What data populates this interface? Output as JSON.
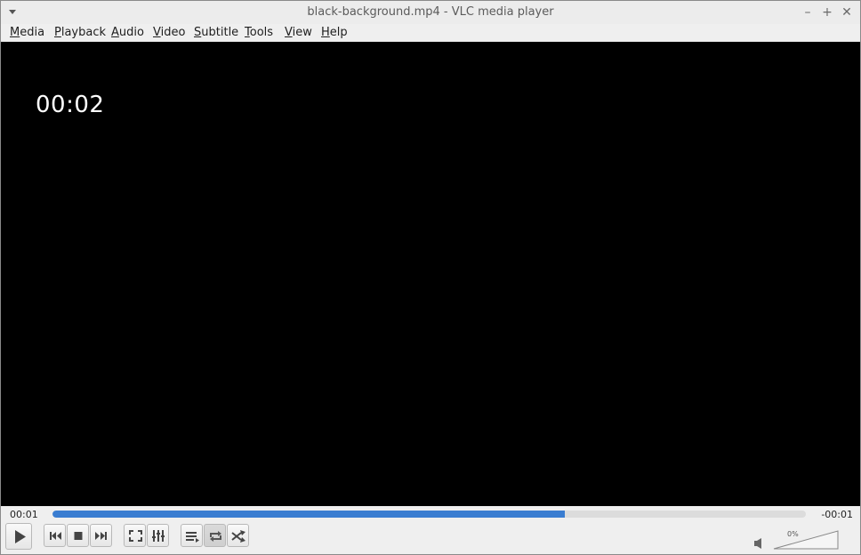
{
  "window": {
    "title": "black-background.mp4 - VLC media player"
  },
  "menubar": {
    "items": [
      {
        "mnemonic": "M",
        "rest": "edia"
      },
      {
        "mnemonic": "P",
        "rest": "layback"
      },
      {
        "mnemonic": "A",
        "rest": "udio"
      },
      {
        "mnemonic": "V",
        "rest": "ideo"
      },
      {
        "mnemonic": "S",
        "rest": "ubtitle"
      },
      {
        "mnemonic": "T",
        "rest": "ools"
      },
      {
        "mnemonic": "V",
        "rest": "iew"
      },
      {
        "mnemonic": "H",
        "rest": "elp"
      }
    ]
  },
  "video": {
    "osd_timestamp": "00:02"
  },
  "seekbar": {
    "elapsed": "00:01",
    "remaining": "-00:01",
    "progress_fraction": 0.68
  },
  "controls": {
    "buttons": [
      {
        "name": "play-icon"
      },
      {
        "name": "previous-icon"
      },
      {
        "name": "stop-icon"
      },
      {
        "name": "next-icon"
      },
      {
        "name": "fullscreen-icon"
      },
      {
        "name": "extended-settings-icon"
      },
      {
        "name": "playlist-icon"
      },
      {
        "name": "loop-icon"
      },
      {
        "name": "shuffle-icon"
      }
    ]
  },
  "volume": {
    "label": "0%",
    "level_fraction": 0
  },
  "colors": {
    "accent": "#3a7dd1",
    "video_bg": "#000000"
  }
}
